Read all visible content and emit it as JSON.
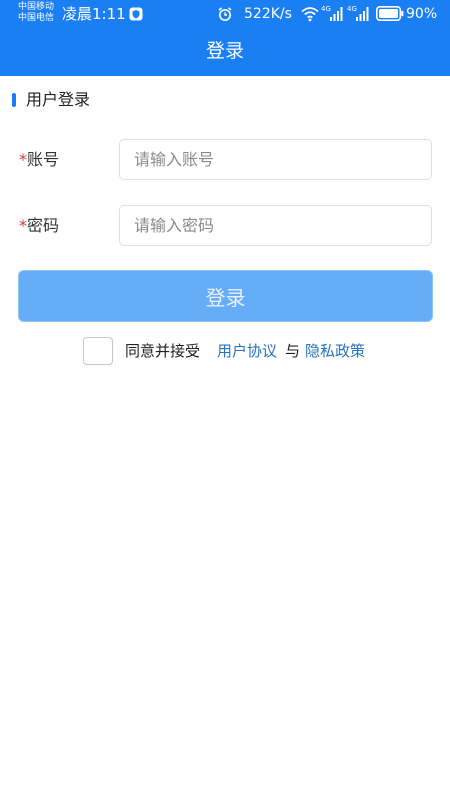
{
  "status_bar": {
    "carrier_1": "中国移动",
    "carrier_2": "中国电信",
    "time": "凌晨1:11",
    "net_speed": "522K/s",
    "signal_1": "4G",
    "signal_2": "4G",
    "battery": "90%"
  },
  "header": {
    "title": "登录"
  },
  "section": {
    "title": "用户登录"
  },
  "form": {
    "required_mark": "*",
    "account_label": "账号",
    "account_placeholder": "请输入账号",
    "password_label": "密码",
    "password_placeholder": "请输入密码",
    "login_button": "登录"
  },
  "agreement": {
    "checked": false,
    "text": "同意并接受",
    "user_agreement": "用户协议",
    "conjunction": "与",
    "privacy_policy": "隐私政策"
  },
  "colors": {
    "primary": "#1a7ff2",
    "button_disabled": "#66adf8",
    "link": "#2573c4",
    "required": "#d9363e"
  },
  "icons": [
    "shield-icon",
    "alarm-icon",
    "wifi-icon",
    "signal-icon",
    "battery-icon"
  ]
}
